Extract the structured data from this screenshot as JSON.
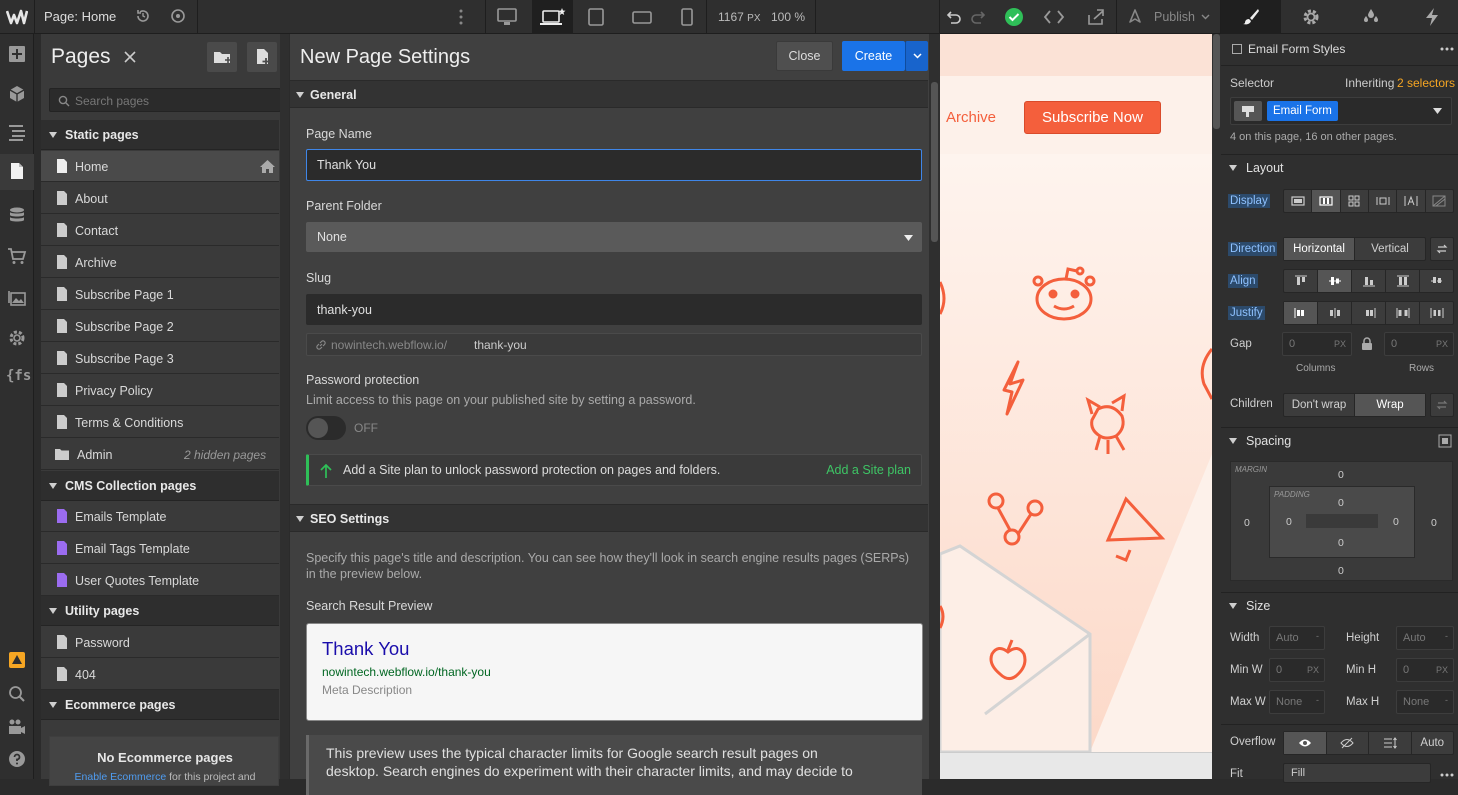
{
  "topbar": {
    "page_prefix": "Page:",
    "page_name": "Home",
    "width_value": "1167",
    "width_unit": "PX",
    "zoom": "100 %",
    "publish_label": "Publish"
  },
  "pages_panel": {
    "title": "Pages",
    "search_placeholder": "Search pages",
    "sections": [
      {
        "label": "Static pages"
      },
      {
        "label": "CMS Collection pages"
      },
      {
        "label": "Utility pages"
      },
      {
        "label": "Ecommerce pages"
      }
    ],
    "static_pages": [
      "Home",
      "About",
      "Contact",
      "Archive",
      "Subscribe Page 1",
      "Subscribe Page 2",
      "Subscribe Page 3",
      "Privacy Policy",
      "Terms & Conditions"
    ],
    "admin": {
      "label": "Admin",
      "note": "2 hidden pages"
    },
    "cms_pages": [
      "Emails Template",
      "Email Tags Template",
      "User Quotes Template"
    ],
    "utility_pages": [
      "Password",
      "404"
    ],
    "ecommerce": {
      "title": "No Ecommerce pages",
      "link": "Enable Ecommerce",
      "rest": " for this project and"
    }
  },
  "settings": {
    "title": "New Page Settings",
    "close_label": "Close",
    "create_label": "Create",
    "general_label": "General",
    "page_name_label": "Page Name",
    "page_name_value": "Thank You",
    "parent_folder_label": "Parent Folder",
    "parent_folder_value": "None",
    "slug_label": "Slug",
    "slug_value": "thank-you",
    "url_base": "nowintech.webflow.io/",
    "url_slug": "thank-you",
    "password_label": "Password protection",
    "password_desc": "Limit access to this page on your published site by setting a password.",
    "toggle_state": "OFF",
    "upsell_text": "Add a Site plan to unlock password protection on pages and folders.",
    "upsell_link": "Add a Site plan",
    "seo_label": "SEO Settings",
    "seo_desc_1": "Specify this page's title and description. You can see how they'll look in search engine results pages (SERPs)",
    "seo_desc_2": "in the preview below.",
    "preview_label": "Search Result Preview",
    "serp_title": "Thank You",
    "serp_url": "nowintech.webflow.io/thank-you",
    "serp_desc": "Meta Description",
    "note_1": "This preview uses the typical character limits for Google search result pages on",
    "note_2": "desktop. Search engines do experiment with their character limits, and may decide to"
  },
  "canvas": {
    "nav_link": "Archive",
    "cta_label": "Subscribe Now",
    "accent": "#f45f3c"
  },
  "style_panel": {
    "element_label": "Email Form Styles",
    "selector_label": "Selector",
    "inheriting_label": "Inheriting",
    "inheriting_count": "2 selectors",
    "class_name": "Email Form",
    "usage_note": "4 on this page, 16 on other pages.",
    "layout_label": "Layout",
    "display_label": "Display",
    "direction_label": "Direction",
    "direction_options": [
      "Horizontal",
      "Vertical"
    ],
    "align_label": "Align",
    "justify_label": "Justify",
    "gap_label": "Gap",
    "gap_columns_value": "0",
    "gap_rows_value": "0",
    "unit_px": "PX",
    "columns_label": "Columns",
    "rows_label": "Rows",
    "children_label": "Children",
    "children_options": [
      "Don't wrap",
      "Wrap"
    ],
    "spacing_label": "Spacing",
    "margin_label": "MARGIN",
    "padding_label": "PADDING",
    "margin": {
      "top": "0",
      "right": "0",
      "bottom": "0",
      "left": "0"
    },
    "padding": {
      "top": "0",
      "right": "0",
      "bottom": "0",
      "left": "0"
    },
    "size_label": "Size",
    "width_label": "Width",
    "height_label": "Height",
    "minw_label": "Min W",
    "minh_label": "Min H",
    "maxw_label": "Max W",
    "maxh_label": "Max H",
    "auto_value": "Auto",
    "none_value": "None",
    "zero_value": "0",
    "overflow_label": "Overflow",
    "overflow_auto": "Auto",
    "fit_label": "Fit",
    "fit_value": "Fill"
  },
  "colors": {
    "primary_blue": "#1a73e8",
    "success_green": "#2fbf58",
    "accent_orange": "#f6a623"
  }
}
